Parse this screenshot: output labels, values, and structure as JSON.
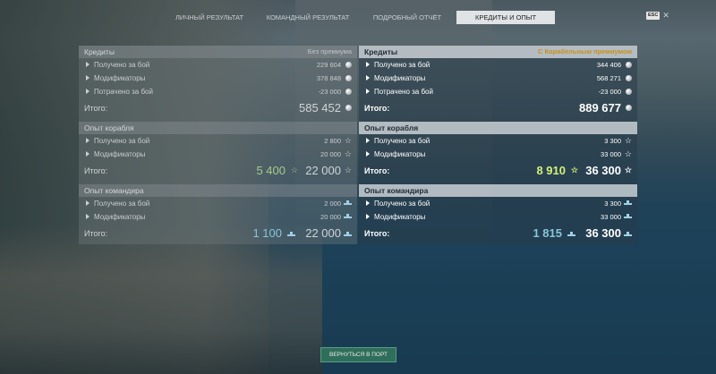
{
  "tabs": [
    {
      "label": "ЛИЧНЫЙ РЕЗУЛЬТАТ",
      "active": false
    },
    {
      "label": "КОМАНДНЫЙ РЕЗУЛЬТАТ",
      "active": false
    },
    {
      "label": "ПОДРОБНЫЙ ОТЧЁТ",
      "active": false
    },
    {
      "label": "КРЕДИТЫ И ОПЫТ",
      "active": true
    }
  ],
  "esc": {
    "key": "ESC",
    "close_glyph": "✕"
  },
  "left": {
    "credits": {
      "title": "Кредиты",
      "note": "Без премиума",
      "rows": [
        {
          "label": "Получено за бой",
          "value": "229 604"
        },
        {
          "label": "Модификаторы",
          "value": "378 848"
        },
        {
          "label": "Потрачено за бой",
          "value": "-23 000"
        }
      ],
      "total_label": "Итого:",
      "total": "585 452"
    },
    "ship_xp": {
      "title": "Опыт корабля",
      "rows": [
        {
          "label": "Получено за бой",
          "value": "2 800"
        },
        {
          "label": "Модификаторы",
          "value": "20 000"
        }
      ],
      "total_label": "Итого:",
      "free_total": "5 400",
      "total": "22 000"
    },
    "commander_xp": {
      "title": "Опыт командира",
      "rows": [
        {
          "label": "Получено за бой",
          "value": "2 000"
        },
        {
          "label": "Модификаторы",
          "value": "20 000"
        }
      ],
      "total_label": "Итого:",
      "free_total": "1 100",
      "total": "22 000"
    }
  },
  "right": {
    "credits": {
      "title": "Кредиты",
      "note": "С Корабельным премиумом",
      "rows": [
        {
          "label": "Получено за бой",
          "value": "344 406"
        },
        {
          "label": "Модификаторы",
          "value": "568 271"
        },
        {
          "label": "Потрачено за бой",
          "value": "-23 000"
        }
      ],
      "total_label": "Итого:",
      "total": "889 677"
    },
    "ship_xp": {
      "title": "Опыт корабля",
      "rows": [
        {
          "label": "Получено за бой",
          "value": "3 300"
        },
        {
          "label": "Модификаторы",
          "value": "33 000"
        }
      ],
      "total_label": "Итого:",
      "free_total": "8 910",
      "total": "36 300"
    },
    "commander_xp": {
      "title": "Опыт командира",
      "rows": [
        {
          "label": "Получено за бой",
          "value": "3 300"
        },
        {
          "label": "Модификаторы",
          "value": "33 000"
        }
      ],
      "total_label": "Итого:",
      "free_total": "1 815",
      "total": "36 300"
    }
  },
  "icons": {
    "credits": "credits-coin-icon",
    "ship_xp": "star-icon",
    "commander_xp": "commander-ship-icon"
  },
  "colors": {
    "premium_note": "#c8901a",
    "free_xp_green": "#a8c98a",
    "free_xp_lime": "#d4f07a",
    "commander_cyan": "#86c6dc",
    "port_button": "#2f6e5a"
  },
  "port_button": {
    "label": "ВЕРНУТЬСЯ В ПОРТ"
  }
}
